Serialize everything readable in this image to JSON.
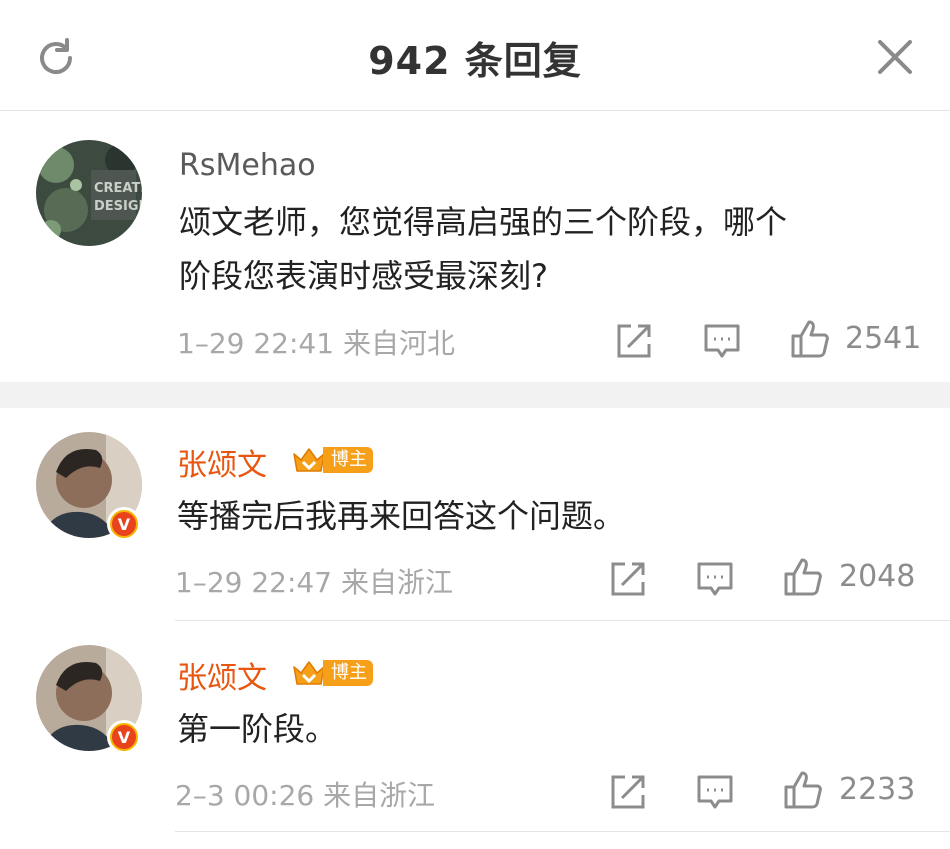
{
  "header": {
    "title": "942 条回复",
    "refresh_icon": "refresh-icon",
    "close_icon": "close-icon"
  },
  "comments": [
    {
      "username": "RsMehao",
      "text_lines": [
        "颂文老师，您觉得高启强的三个阶段，哪个",
        "阶段您表演时感受最深刻?"
      ],
      "time": "1–29 22:41",
      "location": "来自河北",
      "likes": "2541"
    },
    {
      "username": "张颂文",
      "badge": "博主",
      "text_lines": [
        "等播完后我再来回答这个问题。"
      ],
      "time": "1–29 22:47",
      "location": "来自浙江",
      "likes": "2048"
    },
    {
      "username": "张颂文",
      "badge": "博主",
      "text_lines": [
        "第一阶段。"
      ],
      "time": "2–3 00:26",
      "location": "来自浙江",
      "likes": "2233"
    }
  ],
  "icons": {
    "share": "share-icon",
    "comment": "comment-icon",
    "like": "thumbs-up-icon",
    "verified": "verified-v-icon",
    "crown": "crown-icon"
  },
  "verified_glyph": "V",
  "colors": {
    "author_name": "#e8560f",
    "badge_bg": "#f6a01a",
    "verified": "#e8431d",
    "meta": "#a8a8a8"
  }
}
